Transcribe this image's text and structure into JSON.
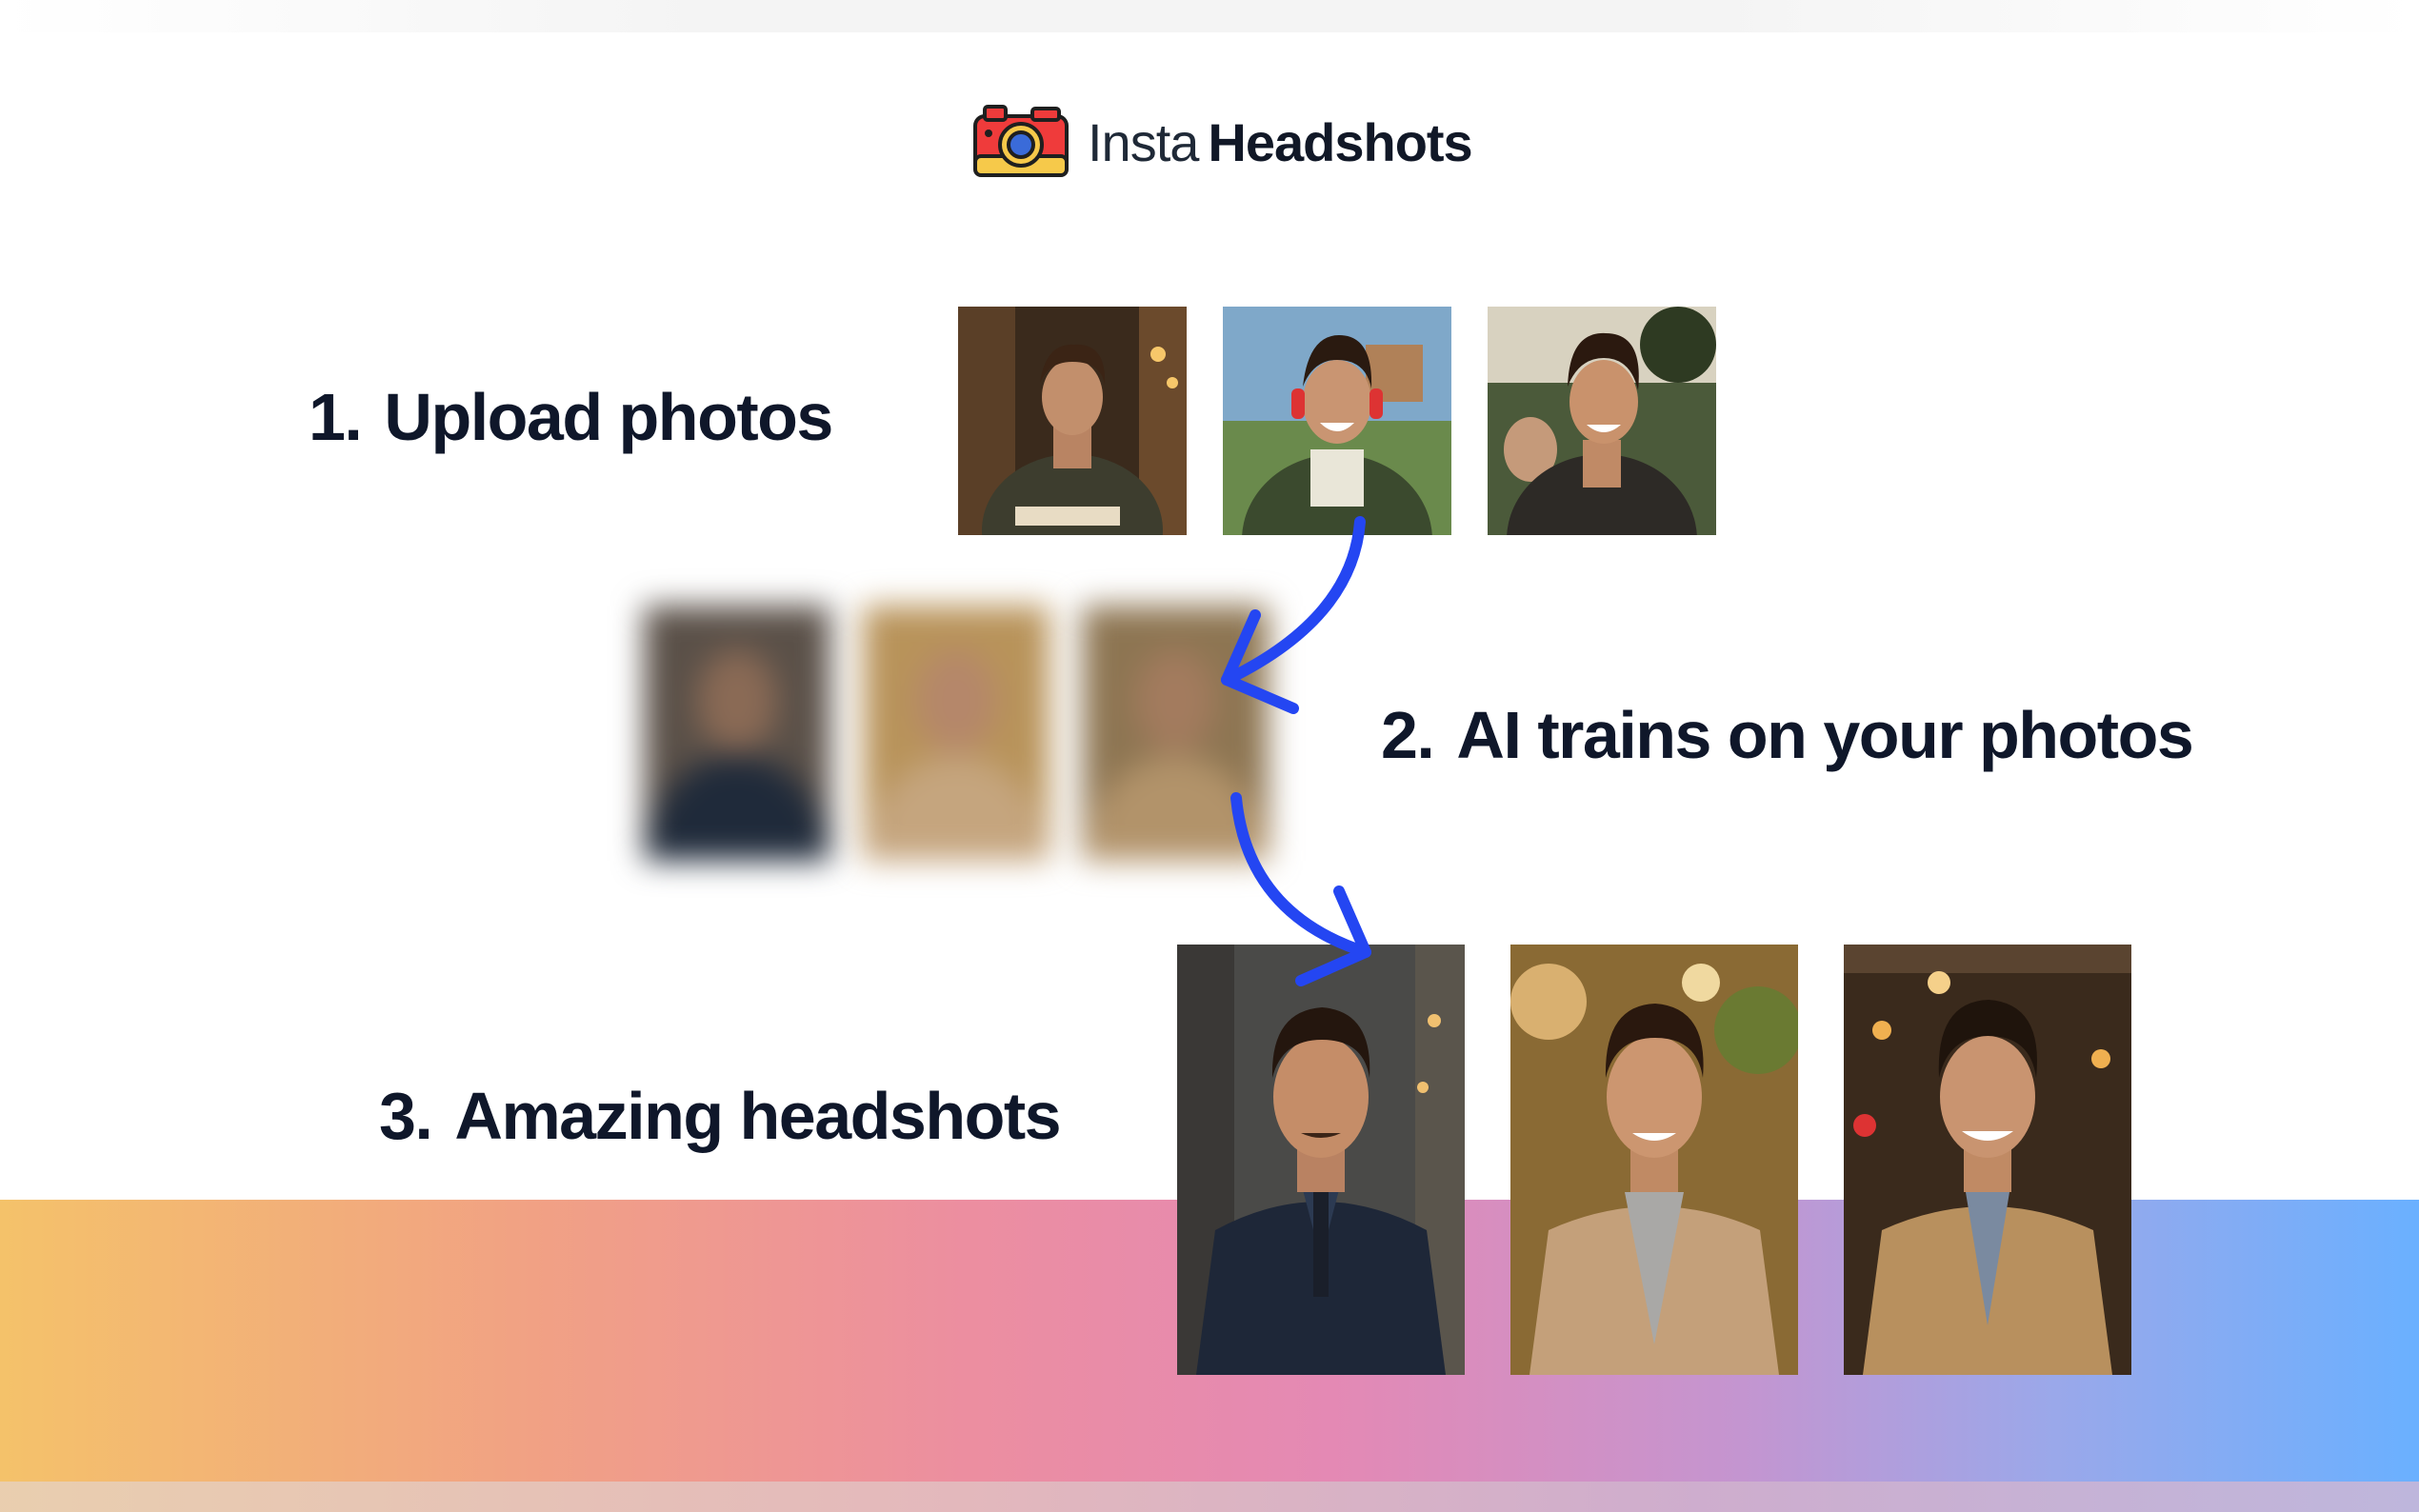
{
  "brand": {
    "name_light": "Insta",
    "name_bold": "Headshots",
    "icon": "camera-icon"
  },
  "steps": [
    {
      "number": "1.",
      "label": "Upload photos"
    },
    {
      "number": "2.",
      "label": "AI trains on your photos"
    },
    {
      "number": "3.",
      "label": "Amazing headshots"
    }
  ],
  "colors": {
    "arrow": "#2446f2",
    "text": "#0f172a",
    "band_start": "#f4c26a",
    "band_end": "#6ab0ff"
  },
  "icons": [
    "camera-icon",
    "curved-arrow-icon"
  ]
}
